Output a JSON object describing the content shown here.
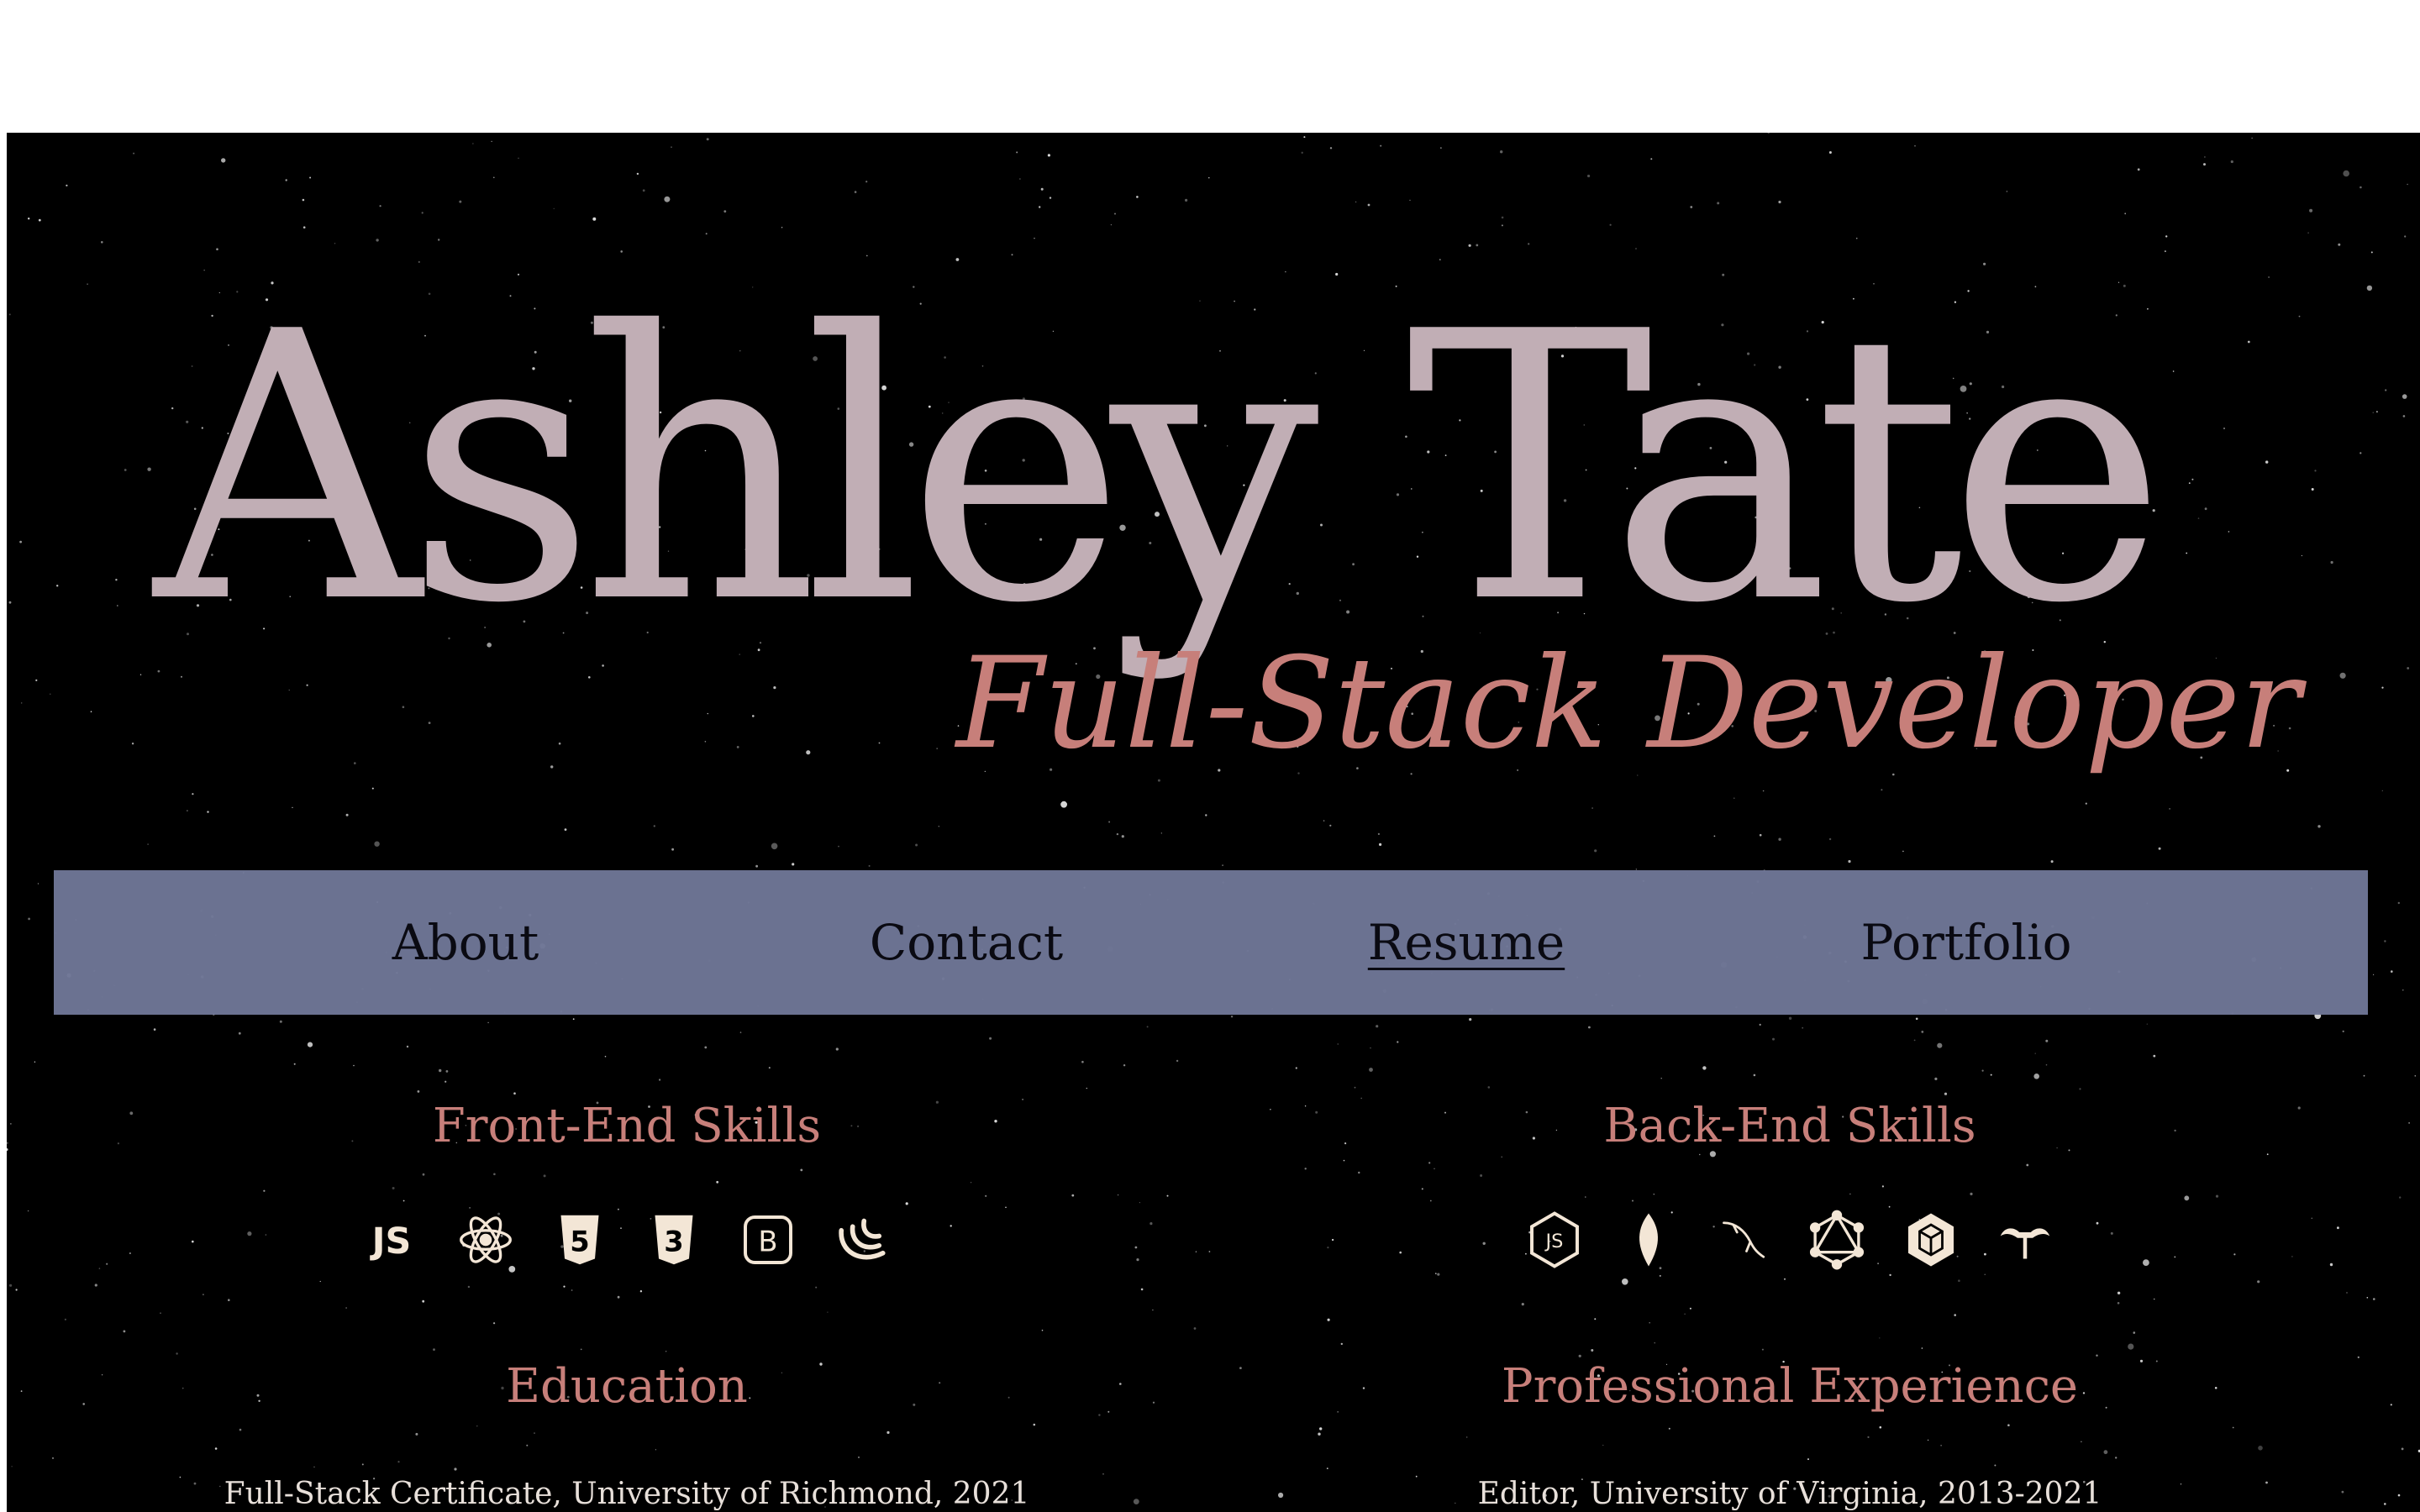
{
  "hero": {
    "name": "Ashley Tate",
    "role": "Full-Stack Developer"
  },
  "nav": {
    "items": [
      {
        "label": "About",
        "active": false
      },
      {
        "label": "Contact",
        "active": false
      },
      {
        "label": "Resume",
        "active": true
      },
      {
        "label": "Portfolio",
        "active": false
      }
    ]
  },
  "front_end": {
    "title": "Front-End Skills",
    "icons": [
      "javascript-icon",
      "react-icon",
      "html5-icon",
      "css3-icon",
      "bootstrap-icon",
      "jquery-icon"
    ]
  },
  "back_end": {
    "title": "Back-End Skills",
    "icons": [
      "nodejs-icon",
      "mongodb-icon",
      "mysql-icon",
      "graphql-icon",
      "sequelize-icon",
      "express-icon"
    ]
  },
  "education": {
    "title": "Education",
    "entry": "Full-Stack Certificate, University of Richmond, 2021"
  },
  "experience": {
    "title": "Professional Experience",
    "entry": "Editor, University of Virginia, 2013-2021"
  },
  "colors": {
    "name": "#c1aeb5",
    "accent": "#c77f7a",
    "nav_background": "#6e7696",
    "icon": "#f3e6d6",
    "background": "#000000"
  }
}
